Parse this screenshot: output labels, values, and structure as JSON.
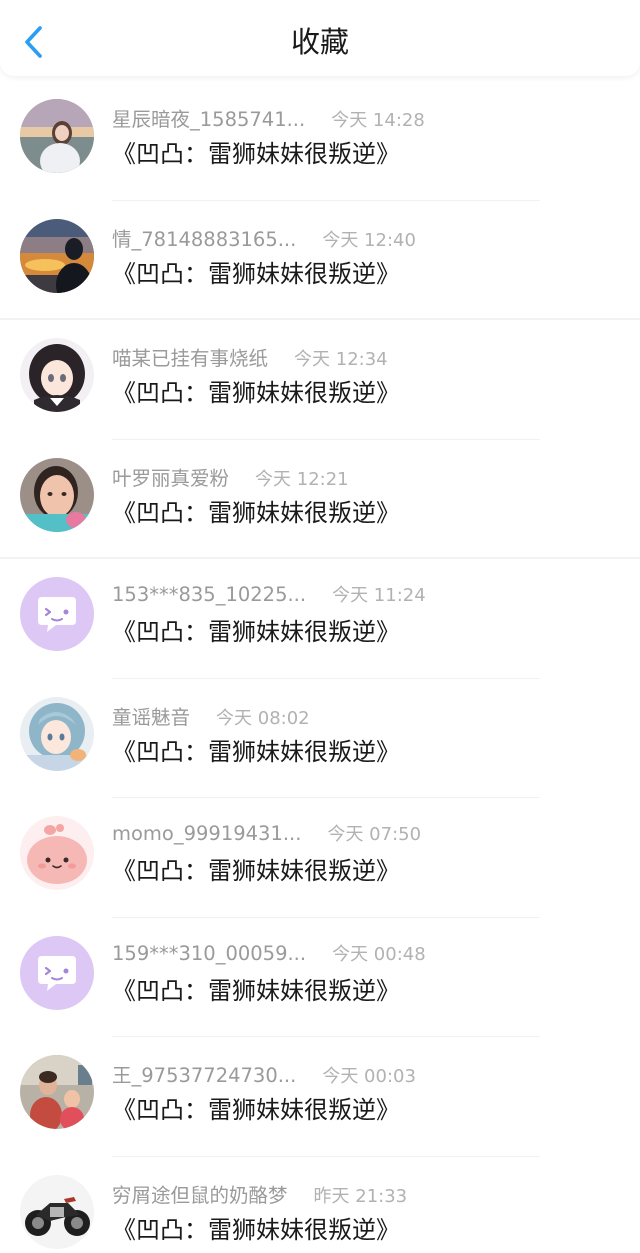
{
  "header": {
    "title": "收藏",
    "back_icon": "chevron-left-icon",
    "accent_color": "#2a9df4"
  },
  "favorites": [
    {
      "user": "星辰暗夜_1585741...",
      "time": "今天 14:28",
      "title": "《凹凸：雷狮妹妹很叛逆》",
      "avatar": "photo-avatar"
    },
    {
      "user": "情_78148883165...",
      "time": "今天 12:40",
      "title": "《凹凸：雷狮妹妹很叛逆》",
      "avatar": "photo-avatar"
    },
    {
      "user": "喵某已挂有事烧纸",
      "time": "今天 12:34",
      "title": "《凹凸：雷狮妹妹很叛逆》",
      "avatar": "anime-avatar"
    },
    {
      "user": "叶罗丽真爱粉",
      "time": "今天 12:21",
      "title": "《凹凸：雷狮妹妹很叛逆》",
      "avatar": "photo-avatar"
    },
    {
      "user": "153***835_10225...",
      "time": "今天 11:24",
      "title": "《凹凸：雷狮妹妹很叛逆》",
      "avatar": "default-avatar"
    },
    {
      "user": "童谣魅音",
      "time": "今天 08:02",
      "title": "《凹凸：雷狮妹妹很叛逆》",
      "avatar": "anime-avatar"
    },
    {
      "user": "momo_99919431...",
      "time": "今天 07:50",
      "title": "《凹凸：雷狮妹妹很叛逆》",
      "avatar": "cartoon-avatar"
    },
    {
      "user": "159***310_00059...",
      "time": "今天 00:48",
      "title": "《凹凸：雷狮妹妹很叛逆》",
      "avatar": "default-avatar"
    },
    {
      "user": "王_97537724730...",
      "time": "今天 00:03",
      "title": "《凹凸：雷狮妹妹很叛逆》",
      "avatar": "photo-avatar"
    },
    {
      "user": "穷屑途但鼠的奶酪梦",
      "time": "昨天 21:33",
      "title": "《凹凸：雷狮妹妹很叛逆》",
      "avatar": "motorcycle-avatar"
    }
  ]
}
